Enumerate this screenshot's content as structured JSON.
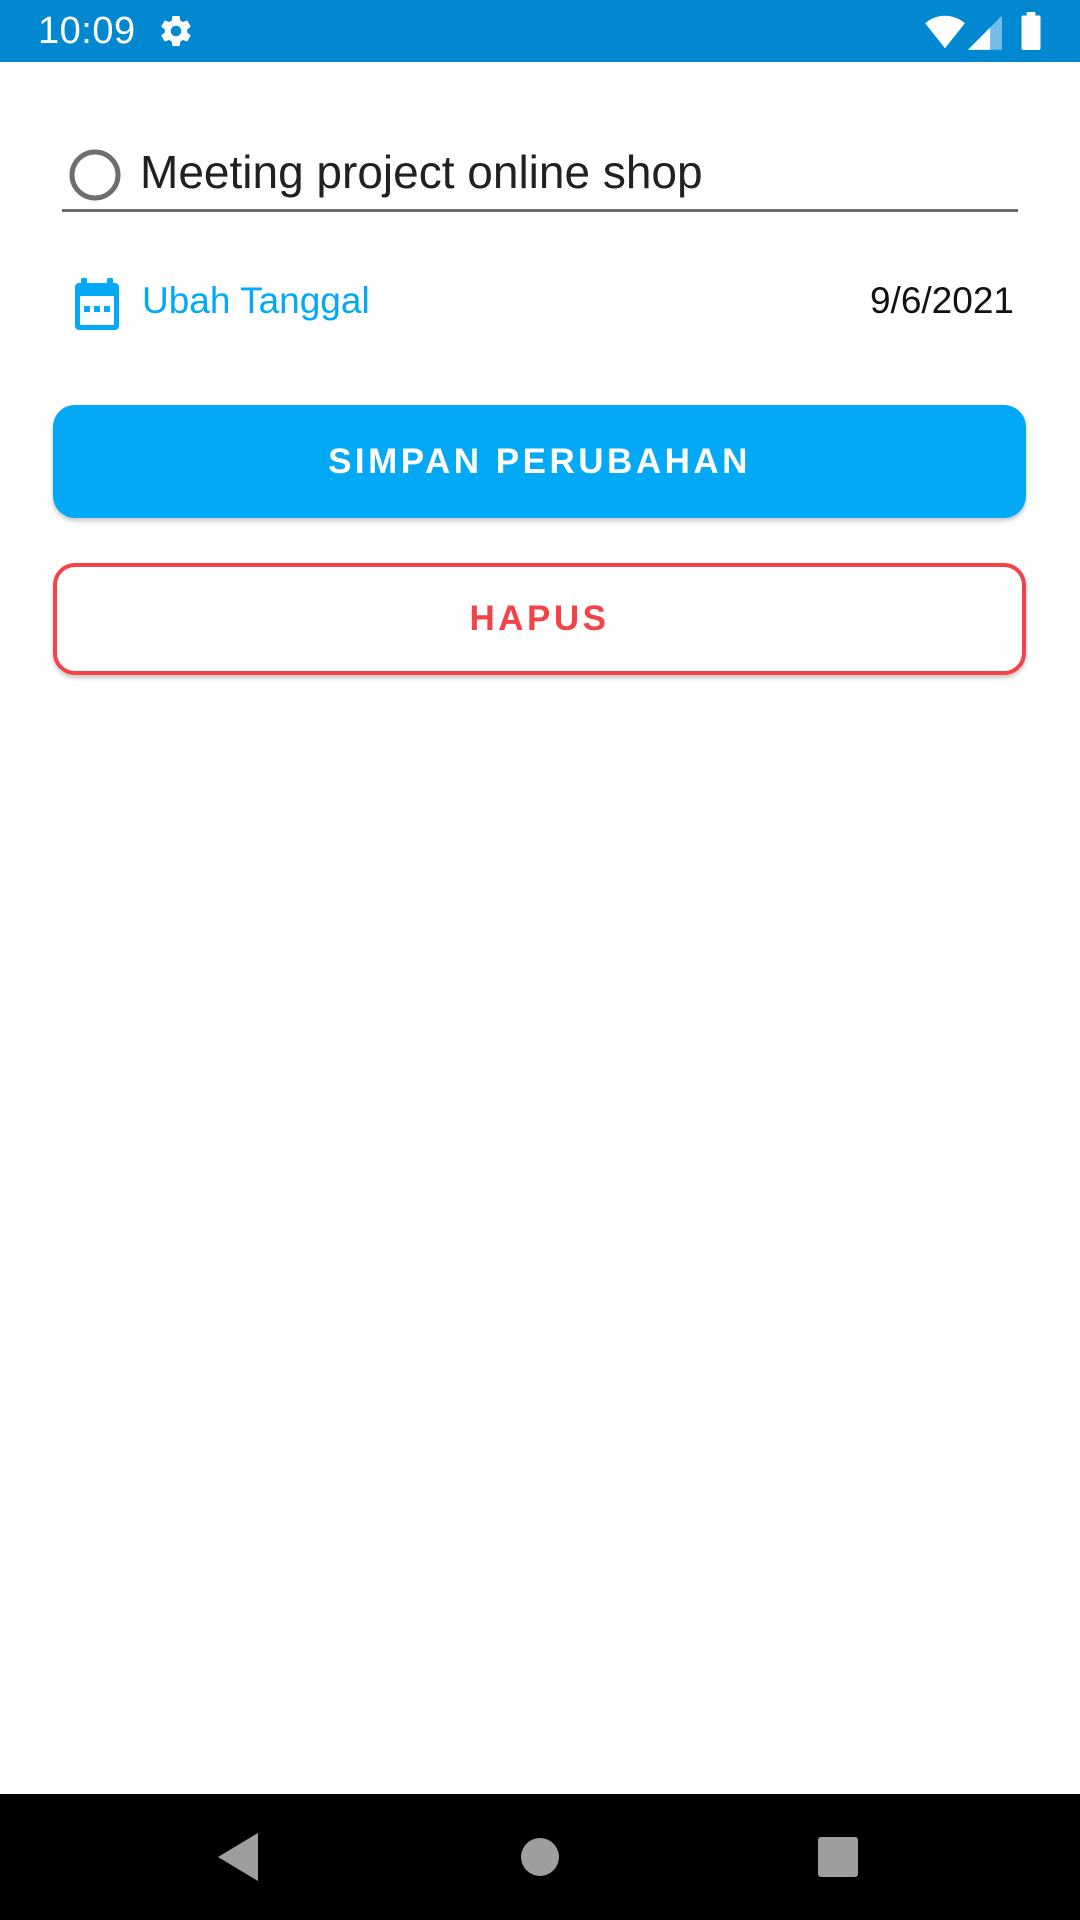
{
  "status_bar": {
    "time": "10:09",
    "background": "#0288d1",
    "icons": [
      "gear-icon",
      "wifi-icon",
      "cell-signal-icon",
      "battery-icon"
    ]
  },
  "task": {
    "title": "Meeting project online shop",
    "completed": false
  },
  "date_row": {
    "change_label": "Ubah Tanggal",
    "date": "9/6/2021",
    "icon": "calendar-icon",
    "accent": "#03a9f4"
  },
  "buttons": {
    "save_label": "SIMPAN PERUBAHAN",
    "save_color": "#03a9f4",
    "delete_label": "HAPUS",
    "delete_color": "#f44346"
  },
  "nav_bar": {
    "icons": [
      "back-icon",
      "home-icon",
      "recents-icon"
    ]
  }
}
